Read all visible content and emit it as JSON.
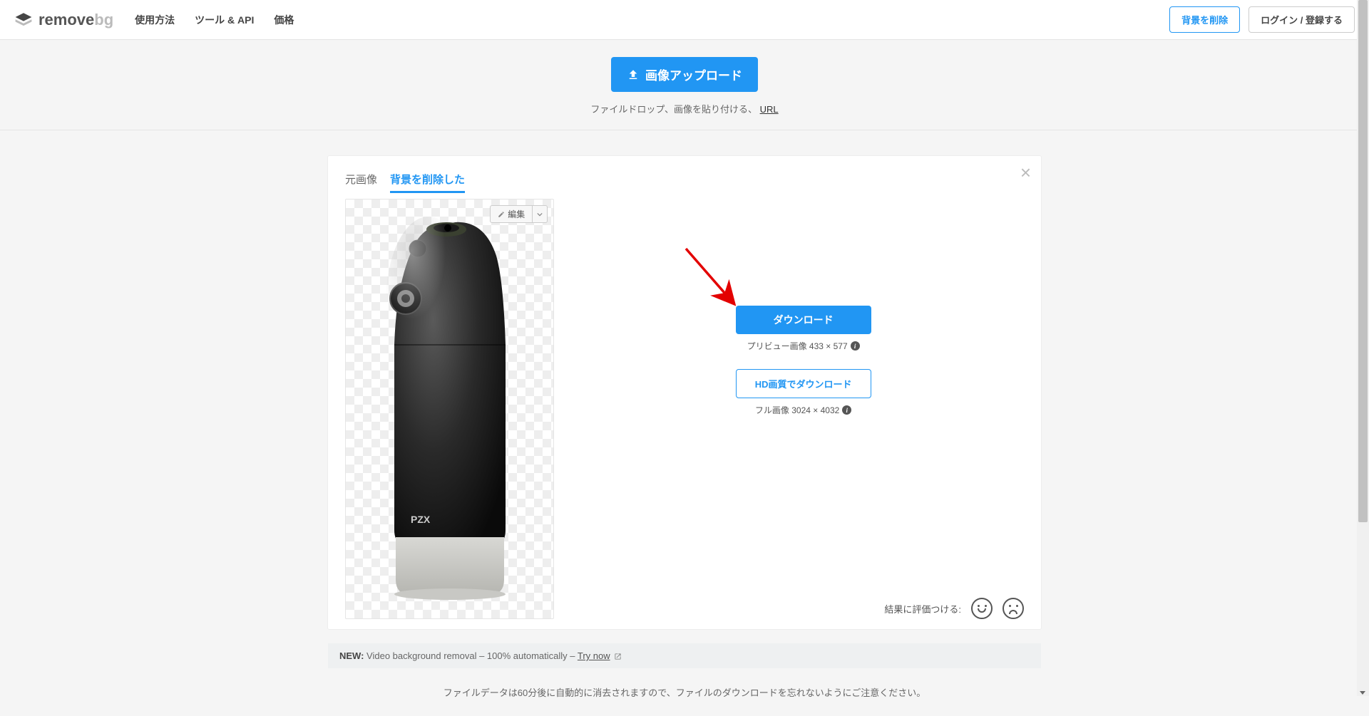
{
  "header": {
    "logo_main": "remove",
    "logo_suffix": "bg",
    "nav": [
      "使用方法",
      "ツール & API",
      "価格"
    ],
    "remove_bg_btn": "背景を削除",
    "login_btn": "ログイン / 登録する"
  },
  "upload": {
    "button": "画像アップロード",
    "hint_prefix": "ファイルドロップ、画像を貼り付ける、",
    "hint_link": "URL"
  },
  "card": {
    "tabs": {
      "original": "元画像",
      "removed": "背景を削除した"
    },
    "edit_btn": "編集",
    "download_btn": "ダウンロード",
    "preview_label": "プリビュー画像 433 × 577",
    "hd_btn": "HD画質でダウンロード",
    "full_label": "フル画像 3024 × 4032",
    "rating_label": "結果に評価つける:"
  },
  "banner": {
    "new_label": "NEW:",
    "text": " Video background removal – 100% automatically – ",
    "link": "Try now"
  },
  "footer": "ファイルデータは60分後に自動的に消去されますので、ファイルのダウンロードを忘れないようにご注意ください。",
  "product_brand": "PZX"
}
